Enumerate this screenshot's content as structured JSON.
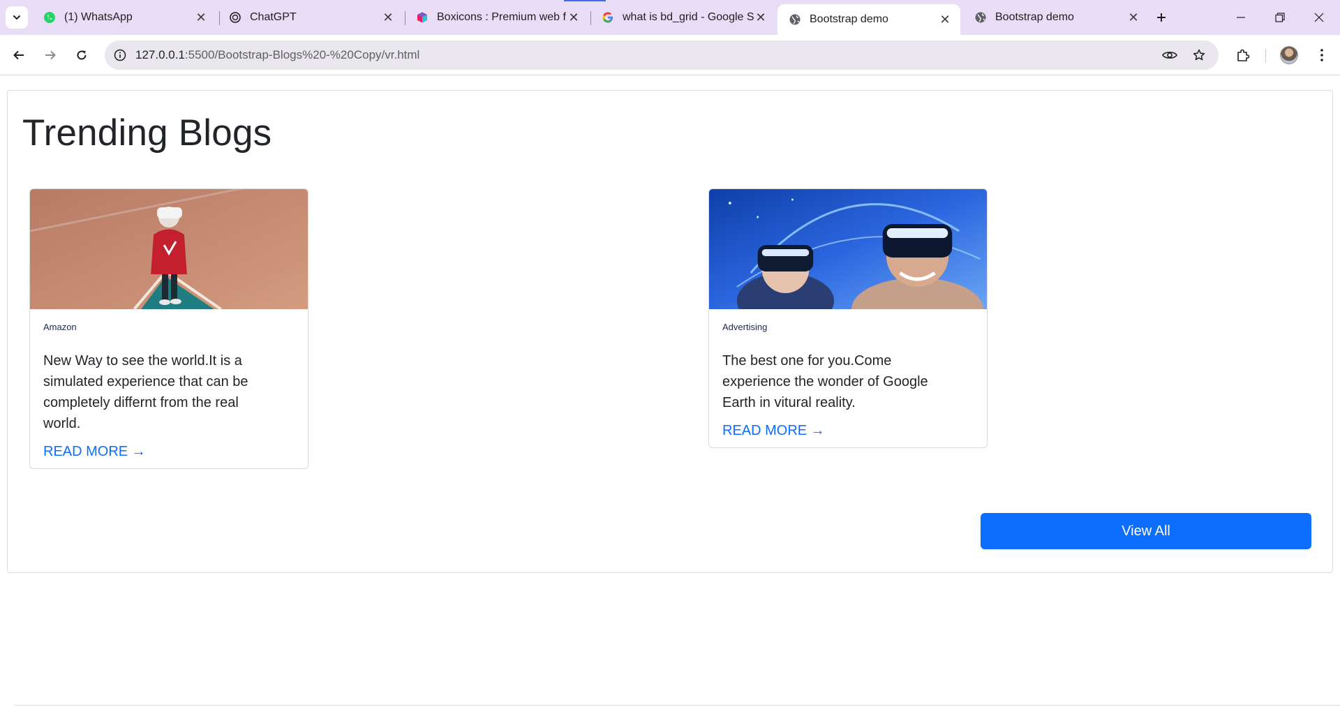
{
  "browser": {
    "tabs": [
      {
        "label": "(1) WhatsApp",
        "icon": "whatsapp-icon",
        "active": false
      },
      {
        "label": "ChatGPT",
        "icon": "chatgpt-icon",
        "active": false
      },
      {
        "label": "Boxicons : Premium web fr",
        "icon": "boxicons-icon",
        "active": false
      },
      {
        "label": "what is bd_grid - Google S",
        "icon": "google-icon",
        "active": false
      },
      {
        "label": "Bootstrap demo",
        "icon": "globe-icon",
        "active": true
      },
      {
        "label": "Bootstrap demo",
        "icon": "globe-icon",
        "active": false
      }
    ],
    "url_host": "127.0.0.1",
    "url_rest": ":5500/Bootstrap-Blogs%20-%20Copy/vr.html"
  },
  "page": {
    "title": "Trending Blogs",
    "cards": [
      {
        "category": "Amazon",
        "text": "New Way to see the world.It is a simulated experience that can be completely differnt from the real world.",
        "link": "READ MORE →"
      },
      {
        "category": "Advertising",
        "text": "The best one for you.Come experience the wonder of Google Earth in vitural reality.",
        "link": "READ MORE →"
      }
    ],
    "view_all": "View All"
  },
  "colors": {
    "tabstrip": "#e8dcf7",
    "primary": "#0d6efd",
    "text": "#212529"
  }
}
